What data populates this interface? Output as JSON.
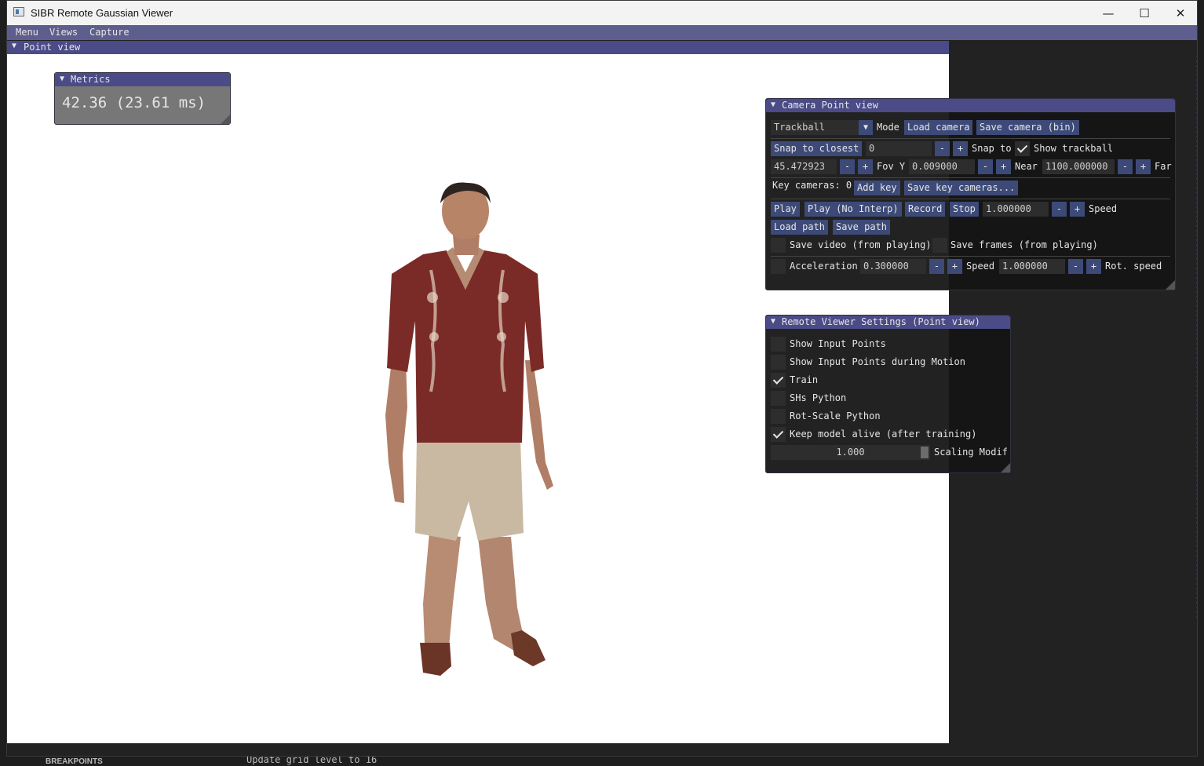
{
  "window": {
    "title": "SIBR Remote Gaussian Viewer"
  },
  "menubar": {
    "items": [
      "Menu",
      "Views",
      "Capture"
    ]
  },
  "point_view": {
    "title": "Point view"
  },
  "metrics": {
    "title": "Metrics",
    "value": "42.36 (23.61 ms)"
  },
  "camera_panel": {
    "title": "Camera Point view",
    "mode_select": "Trackball",
    "mode_label": "Mode",
    "load_camera": "Load camera",
    "save_camera": "Save camera (bin)",
    "snap_to_closest": "Snap to closest",
    "snap_value": "0",
    "snap_to_label": "Snap to",
    "show_trackball_label": "Show trackball",
    "show_trackball_checked": true,
    "fov_value": "45.472923",
    "fov_label": "Fov Y",
    "near_value": "0.009000",
    "near_label": "Near",
    "far_value": "1100.000000",
    "far_label": "Far",
    "key_cameras_label": "Key cameras: 0",
    "add_key": "Add key",
    "save_key_cameras": "Save key cameras...",
    "play": "Play",
    "play_no_interp": "Play (No Interp)",
    "record": "Record",
    "stop": "Stop",
    "speed_value": "1.000000",
    "speed_label": "Speed",
    "load_path": "Load path",
    "save_path": "Save path",
    "save_video_label": "Save video (from playing)",
    "save_frames_label": "Save frames (from playing)",
    "acceleration_label": "Acceleration",
    "acceleration_value": "0.300000",
    "speed2_label": "Speed",
    "speed2_value": "1.000000",
    "rot_speed_label": "Rot. speed",
    "minus": "-",
    "plus": "+"
  },
  "remote_panel": {
    "title": "Remote Viewer Settings (Point view)",
    "options": [
      {
        "label": "Show Input Points",
        "checked": false
      },
      {
        "label": "Show Input Points during Motion",
        "checked": false
      },
      {
        "label": "Train",
        "checked": true
      },
      {
        "label": "SHs Python",
        "checked": false
      },
      {
        "label": "Rot-Scale Python",
        "checked": false
      },
      {
        "label": "Keep model alive (after training)",
        "checked": true
      }
    ],
    "scaling_value": "1.000",
    "scaling_label": "Scaling Modif"
  },
  "background_editor": {
    "breakpoints": "BREAKPOINTS",
    "log_line": "Update grid level to 16"
  },
  "colors": {
    "header": "#4b4b88",
    "button": "#3d4a78",
    "panel_bg": "#141414"
  }
}
